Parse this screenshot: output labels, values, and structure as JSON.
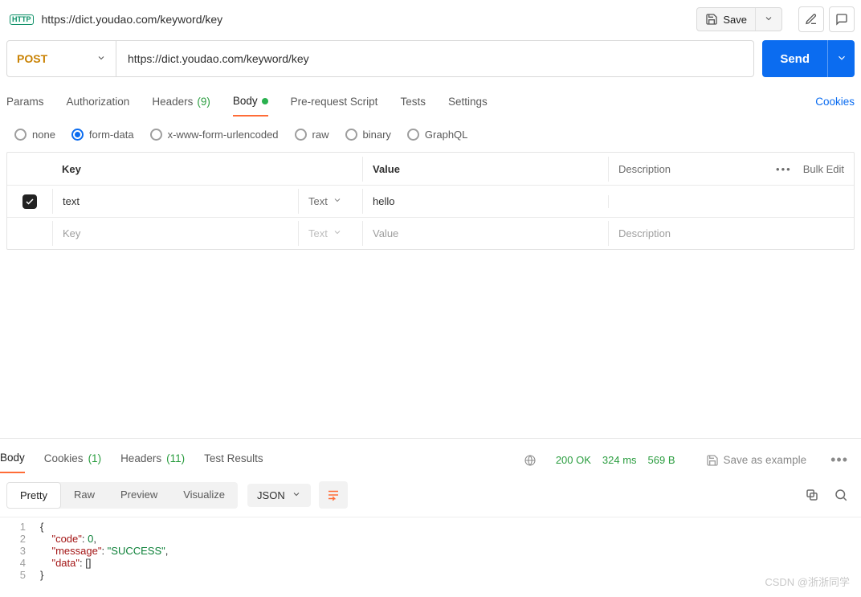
{
  "header": {
    "badge": "HTTP",
    "title": "https://dict.youdao.com/keyword/key",
    "save_label": "Save"
  },
  "request": {
    "method": "POST",
    "url": "https://dict.youdao.com/keyword/key",
    "send_label": "Send"
  },
  "tabs": {
    "params": "Params",
    "auth": "Authorization",
    "headers_label": "Headers",
    "headers_count": "(9)",
    "body": "Body",
    "prerequest": "Pre-request Script",
    "tests": "Tests",
    "settings": "Settings",
    "cookies": "Cookies"
  },
  "body_types": {
    "none": "none",
    "formdata": "form-data",
    "urlencoded": "x-www-form-urlencoded",
    "raw": "raw",
    "binary": "binary",
    "graphql": "GraphQL"
  },
  "kv": {
    "h_key": "Key",
    "h_value": "Value",
    "h_desc": "Description",
    "bulk": "Bulk Edit",
    "type_label": "Text",
    "row1_key": "text",
    "row1_value": "hello",
    "ph_key": "Key",
    "ph_value": "Value",
    "ph_desc": "Description"
  },
  "response": {
    "tabs": {
      "body": "Body",
      "cookies": "Cookies",
      "cookies_count": "(1)",
      "headers": "Headers",
      "headers_count": "(11)",
      "tests": "Test Results"
    },
    "status_code": "200 OK",
    "time": "324 ms",
    "size": "569 B",
    "save_example": "Save as example",
    "view": {
      "pretty": "Pretty",
      "raw": "Raw",
      "preview": "Preview",
      "visualize": "Visualize",
      "lang": "JSON"
    },
    "json_lines": [
      {
        "n": "1",
        "indent": 0,
        "html": "<span class='tok-punc'>{</span>"
      },
      {
        "n": "2",
        "indent": 1,
        "html": "<span class='tok-key'>\"code\"</span><span class='tok-punc'>: </span><span class='tok-num'>0</span><span class='tok-punc'>,</span>"
      },
      {
        "n": "3",
        "indent": 1,
        "html": "<span class='tok-key'>\"message\"</span><span class='tok-punc'>: </span><span class='tok-str'>\"SUCCESS\"</span><span class='tok-punc'>,</span>"
      },
      {
        "n": "4",
        "indent": 1,
        "html": "<span class='tok-key'>\"data\"</span><span class='tok-punc'>: []</span>"
      },
      {
        "n": "5",
        "indent": 0,
        "html": "<span class='tok-punc'>}</span>"
      }
    ]
  },
  "watermark": "CSDN @浙浙同学"
}
